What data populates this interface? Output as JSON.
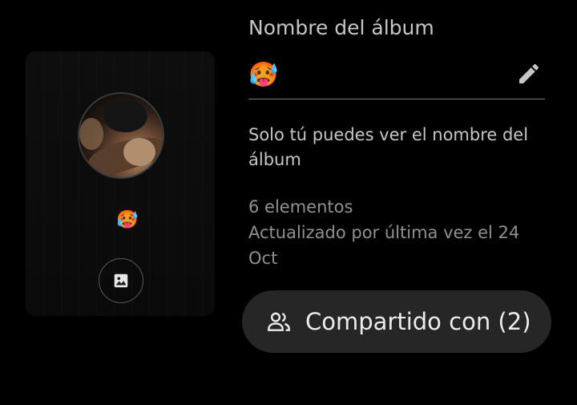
{
  "cover": {
    "emoji": "🥵",
    "change_image_icon": "image-icon"
  },
  "album_name": {
    "label": "Nombre del álbum",
    "value": "🥵",
    "edit_icon": "pencil-icon"
  },
  "help_text": "Solo tú puedes ver el nombre del álbum",
  "details": {
    "item_count": "6 elementos",
    "updated": "Actualizado por última vez el 24 Oct"
  },
  "share_button": {
    "icon": "people-icon",
    "label": "Compartido con (2)"
  },
  "colors": {
    "background": "#000000",
    "button_bg": "#262626",
    "text": "#e3e3e3"
  }
}
